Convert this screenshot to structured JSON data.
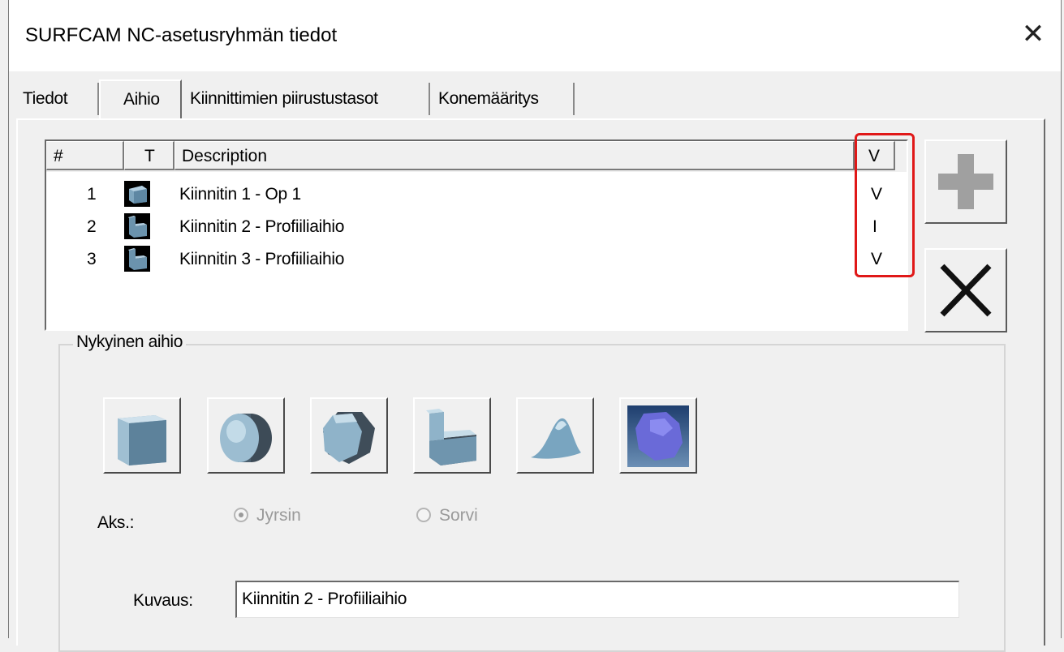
{
  "window": {
    "title": "SURFCAM NC-asetusryhmän tiedot",
    "close_label": "✕"
  },
  "tabs": [
    {
      "label": "Tiedot"
    },
    {
      "label": "Aihio"
    },
    {
      "label": "Kiinnittimien piirustustasot"
    },
    {
      "label": "Konemääritys"
    }
  ],
  "list": {
    "headers": {
      "num": "#",
      "type": "T",
      "description": "Description",
      "v": "V"
    },
    "rows": [
      {
        "num": "1",
        "description": "Kiinnitin 1 - Op 1",
        "v": "V",
        "icon": "block-icon"
      },
      {
        "num": "2",
        "description": "Kiinnitin 2 - Profiiliaihio",
        "v": "I",
        "icon": "profile-icon"
      },
      {
        "num": "3",
        "description": "Kiinnitin 3 - Profiiliaihio",
        "v": "V",
        "icon": "profile-icon"
      }
    ]
  },
  "side_buttons": {
    "add_icon": "plus-icon",
    "delete_icon": "x-icon"
  },
  "group": {
    "label": "Nykyinen aihio",
    "shapes": [
      "box-icon",
      "cylinder-icon",
      "polygon-icon",
      "profile-icon",
      "surface-icon",
      "stl-icon"
    ],
    "axis_label": "Aks.:",
    "radio_mill": "Jyrsin",
    "radio_lathe": "Sorvi",
    "description_label": "Kuvaus:",
    "description_value": "Kiinnitin 2 - Profiiliaihio"
  },
  "colors": {
    "highlight": "#e01818",
    "shape_fill": "#8fb3c9",
    "add_disabled": "#a0a0a0"
  }
}
